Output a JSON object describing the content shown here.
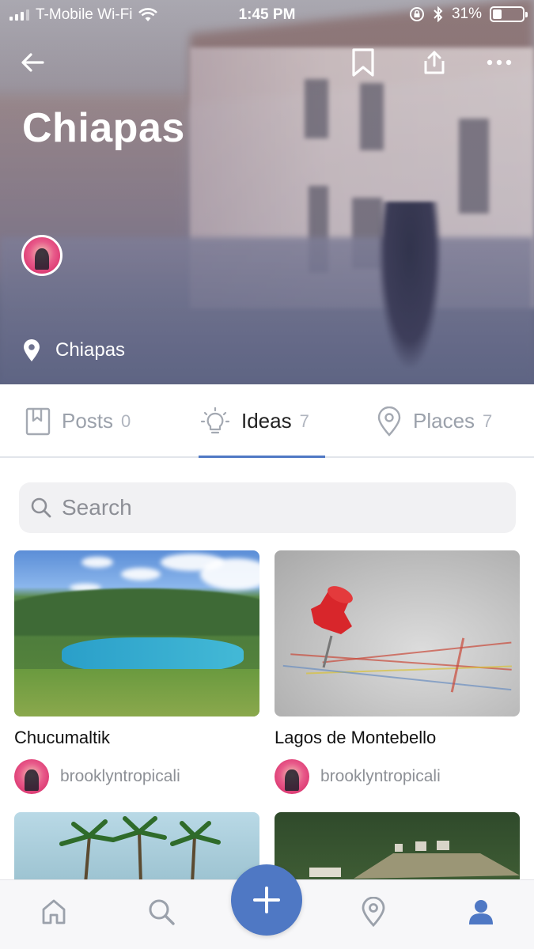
{
  "status_bar": {
    "carrier": "T-Mobile Wi-Fi",
    "time": "1:45 PM",
    "battery": "31%",
    "battery_level": 0.31
  },
  "header": {
    "title": "Chiapas",
    "location": "Chiapas"
  },
  "tabs": [
    {
      "label": "Posts",
      "count": "0",
      "icon": "bookmark-square-icon",
      "active": false
    },
    {
      "label": "Ideas",
      "count": "7",
      "icon": "lightbulb-icon",
      "active": true
    },
    {
      "label": "Places",
      "count": "7",
      "icon": "map-pin-icon",
      "active": false
    }
  ],
  "search": {
    "placeholder": "Search"
  },
  "cards": [
    {
      "title": "Chucumaltik",
      "author": "brooklyntropicali",
      "image": "lake-landscape"
    },
    {
      "title": "Lagos de Montebello",
      "author": "brooklyntropicali",
      "image": "map-pin-photo"
    },
    {
      "title": "",
      "author": "",
      "image": "palm-trees"
    },
    {
      "title": "",
      "author": "",
      "image": "ruins"
    }
  ],
  "colors": {
    "accent": "#4f78c4",
    "tab_inactive": "#9ba1ab",
    "text_primary": "#111111"
  },
  "bottom_nav": [
    {
      "name": "home",
      "icon": "home-icon"
    },
    {
      "name": "search",
      "icon": "search-icon"
    },
    {
      "name": "add",
      "icon": "plus-icon"
    },
    {
      "name": "places",
      "icon": "map-pin-icon"
    },
    {
      "name": "profile",
      "icon": "person-icon"
    }
  ]
}
